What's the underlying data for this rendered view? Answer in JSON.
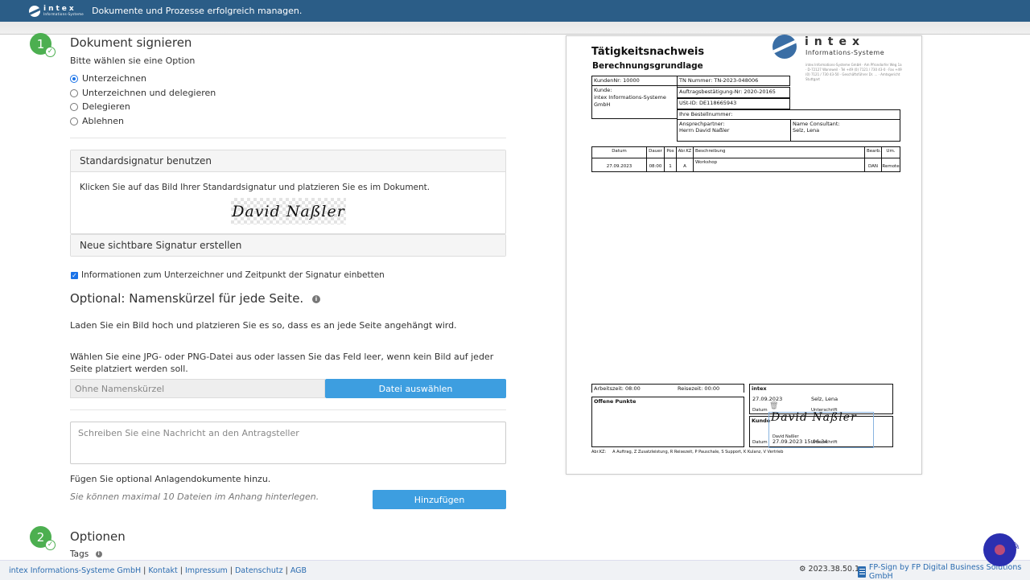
{
  "header": {
    "logo_main": "intex",
    "logo_sub": "Informations-Systeme",
    "tagline": "Dokumente und Prozesse erfolgreich managen."
  },
  "step1": {
    "number": "1",
    "title": "Dokument signieren",
    "prompt": "Bitte wählen sie eine Option",
    "options": [
      {
        "label": "Unterzeichnen",
        "selected": true
      },
      {
        "label": "Unterzeichnen und delegieren",
        "selected": false
      },
      {
        "label": "Delegieren",
        "selected": false
      },
      {
        "label": "Ablehnen",
        "selected": false
      }
    ],
    "standard_sig_title": "Standardsignatur benutzen",
    "standard_sig_instruction": "Klicken Sie auf das Bild Ihrer Standardsignatur und platzieren Sie es im Dokument.",
    "signature_text": "David Naßler",
    "new_sig_title": "Neue sichtbare Signatur erstellen",
    "embed_info_label": "Informationen zum Unterzeichner und Zeitpunkt der Signatur einbetten",
    "embed_info_checked": true,
    "initials_title": "Optional: Namenskürzel für jede Seite.",
    "initials_desc": "Laden Sie ein Bild hoch und platzieren Sie es so, dass es an jede Seite angehängt wird.",
    "file_desc": "Wählen Sie eine JPG- oder PNG-Datei aus oder lassen Sie das Feld leer, wenn kein Bild auf jeder Seite platziert werden soll.",
    "file_placeholder": "Ohne Namenskürzel",
    "file_button": "Datei auswählen",
    "message_placeholder": "Schreiben Sie eine Nachricht an den Antragsteller",
    "attach_label": "Fügen Sie optional Anlagendokumente hinzu.",
    "attach_hint": "Sie können maximal 10 Dateien im Anhang hinterlegen.",
    "attach_button": "Hinzufügen"
  },
  "step2": {
    "number": "2",
    "title": "Optionen",
    "tags_label": "Tags"
  },
  "document": {
    "title": "Tätigkeitsnachweis",
    "subtitle": "Berechnungsgrundlage",
    "logo_main": "intex",
    "logo_sub": "Informations-Systeme",
    "address": "intex Informations-Systeme GmbH · Am Pfrondorfer Weg 1a · D-72127 Wannweil · Tel +49 (0) 7121 / 730 43-0 · Fax +49 (0) 7121 / 730 43-50 · Geschäftsführer Dr. ... · Amtsgericht Stuttgart",
    "kunden_nr": "KundenNr: 10000",
    "tn_nummer": "TN Nummer: TN-2023-048006",
    "auftrag": "Auftragsbestätigung-Nr: 2020-20165",
    "ust_id": "USt-ID: DE118665943",
    "kunde_label": "Kunde:",
    "kunde_value": "intex Informations-Systeme GmbH",
    "bestellnummer": "Ihre Bestellnummer:",
    "ansprech_label": "Ansprechpartner:",
    "ansprech_value": "Herrn David Naßler",
    "consultant_label": "Name Consultant:",
    "consultant_value": "Selz, Lena",
    "table_headers": [
      "Datum",
      "Dauer",
      "Pos",
      "Abr.KZ",
      "Beschreibung",
      "Bearb.",
      "Um."
    ],
    "table_row": [
      "27.09.2023",
      "08:00",
      "1",
      "A",
      "Workshop",
      "DAN",
      "Remote"
    ],
    "arbeitszeit": "Arbeitszeit: 08:00",
    "reisezeit": "Reisezeit: 00:00",
    "offene_punkte": "Offene Punkte",
    "intex_label": "intex",
    "intex_date": "27.09.2023",
    "intex_name": "Selz, Lena",
    "datum_label": "Datum",
    "unterschrift_label": "Unterschrift",
    "kunde_short": "Kunde",
    "sig_signer": "David Naßler",
    "sig_timestamp": "27.09.2023 15:06:34",
    "abr_legend": "Abr.KZ:     A Auftrag, Z Zusatzleistung, R Reisezeit, P Pauschale, S Support, K Kulanz, V Vertrieb"
  },
  "footer": {
    "company": "intex Informations-Systeme GmbH",
    "links": [
      "Kontakt",
      "Impressum",
      "Datenschutz",
      "AGB"
    ],
    "version": "2023.38.50.1",
    "fpsign": "FP-Sign by FP Digital Business Solutions GmbH"
  }
}
